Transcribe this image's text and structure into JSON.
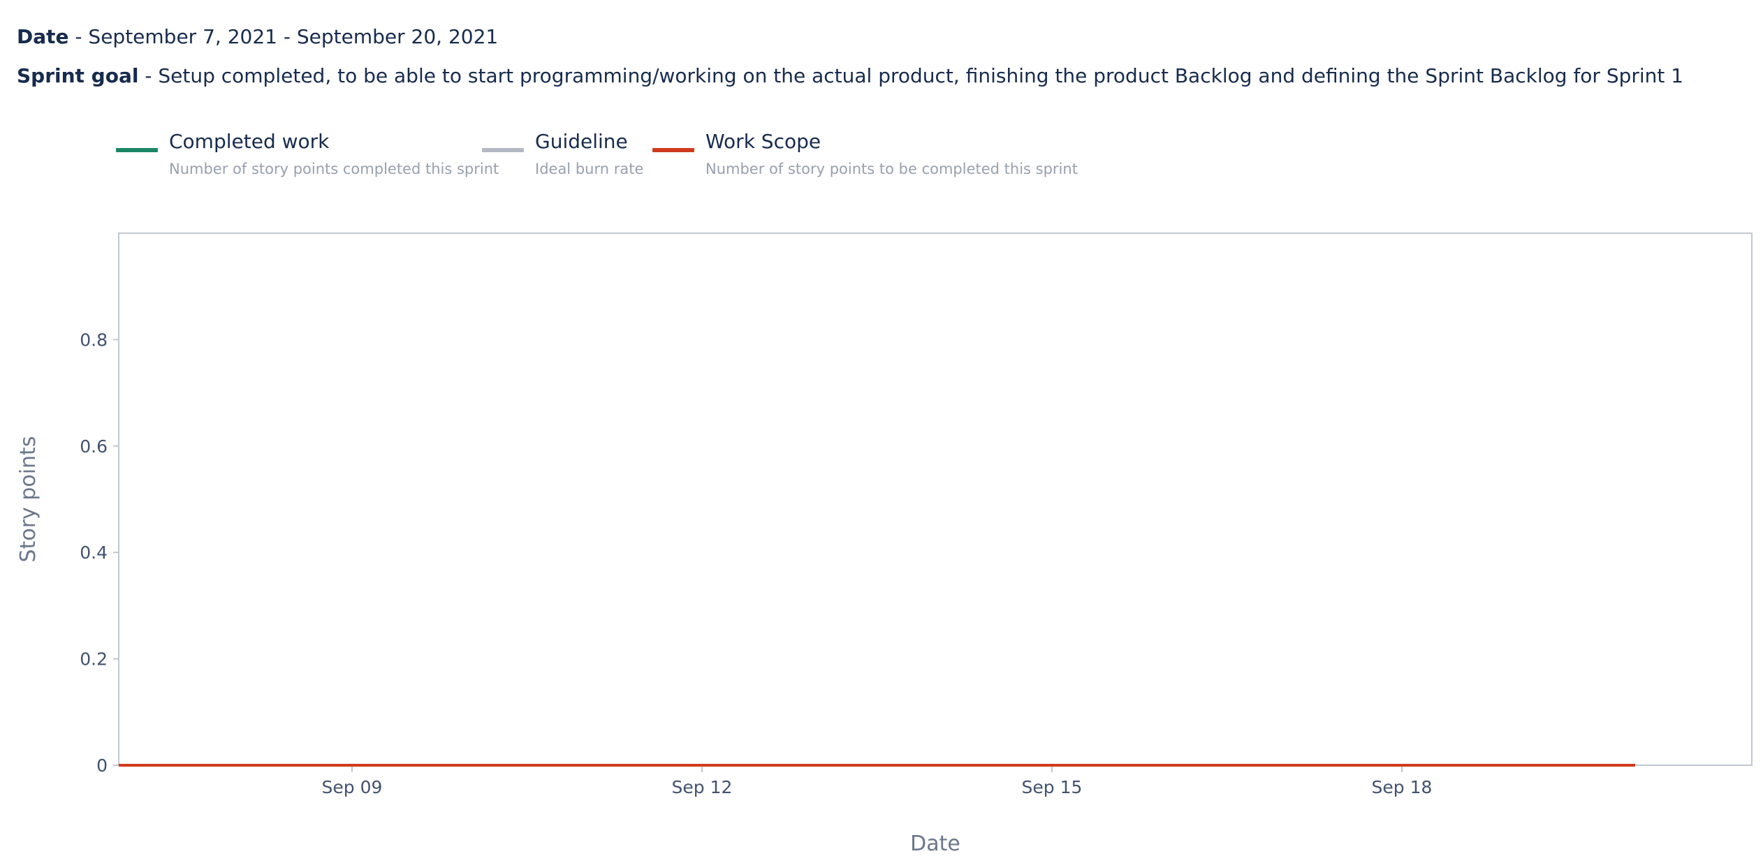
{
  "info": {
    "date_label": "Date",
    "date_value": " - September 7, 2021 - September 20, 2021",
    "goal_label": "Sprint goal",
    "goal_value": " - Setup completed, to be able to start programming/working on the actual product, finishing the product Backlog and defining the Sprint Backlog for Sprint 1"
  },
  "legend": [
    {
      "name": "Completed work",
      "description": "Number of story points completed this sprint",
      "color": "#1b8764"
    },
    {
      "name": "Guideline",
      "description": "Ideal burn rate",
      "color": "#b3b9c4"
    },
    {
      "name": "Work Scope",
      "description": "Number of story points to be completed this sprint",
      "color": "#cf3b1f"
    }
  ],
  "chart_data": {
    "type": "line",
    "xlabel": "Date",
    "ylabel": "Story points",
    "xlim": [
      "2021-09-07",
      "2021-09-21"
    ],
    "ylim": [
      0,
      1
    ],
    "x_ticks": [
      "Sep 09",
      "Sep 12",
      "Sep 15",
      "Sep 18"
    ],
    "x_tick_dates": [
      "2021-09-09",
      "2021-09-12",
      "2021-09-15",
      "2021-09-18"
    ],
    "y_ticks": [
      0,
      0.2,
      0.4,
      0.6,
      0.8
    ],
    "y_tick_labels": [
      "0",
      "0.2",
      "0.4",
      "0.6",
      "0.8"
    ],
    "legend_position": "top-left",
    "grid": false,
    "series": [
      {
        "name": "Guideline",
        "color": "#b3b9c4",
        "x": [
          "2021-09-07",
          "2021-09-20"
        ],
        "y": [
          0,
          0
        ]
      },
      {
        "name": "Work Scope",
        "color": "#cf3b1f",
        "x": [
          "2021-09-07",
          "2021-09-20"
        ],
        "y": [
          0,
          0
        ]
      }
    ]
  }
}
